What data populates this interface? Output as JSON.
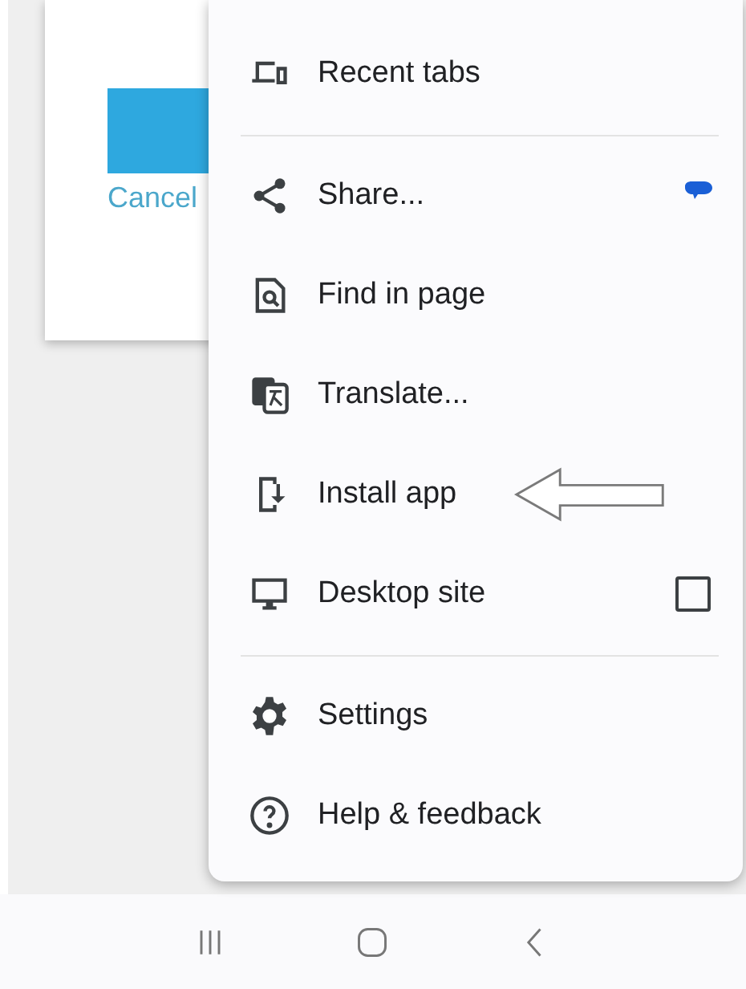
{
  "dialog": {
    "cancel_label": "Cancel"
  },
  "menu": {
    "items": [
      {
        "kind": "link",
        "label": "Recent tabs"
      },
      {
        "kind": "divider"
      },
      {
        "kind": "app-shortcut",
        "label": "Share..."
      },
      {
        "kind": "link",
        "label": "Find in page"
      },
      {
        "kind": "link",
        "label": "Translate..."
      },
      {
        "kind": "link",
        "label": "Install app"
      },
      {
        "kind": "checkbox",
        "label": "Desktop site",
        "checked": false
      },
      {
        "kind": "divider"
      },
      {
        "kind": "link",
        "label": "Settings"
      },
      {
        "kind": "link",
        "label": "Help & feedback"
      }
    ]
  }
}
